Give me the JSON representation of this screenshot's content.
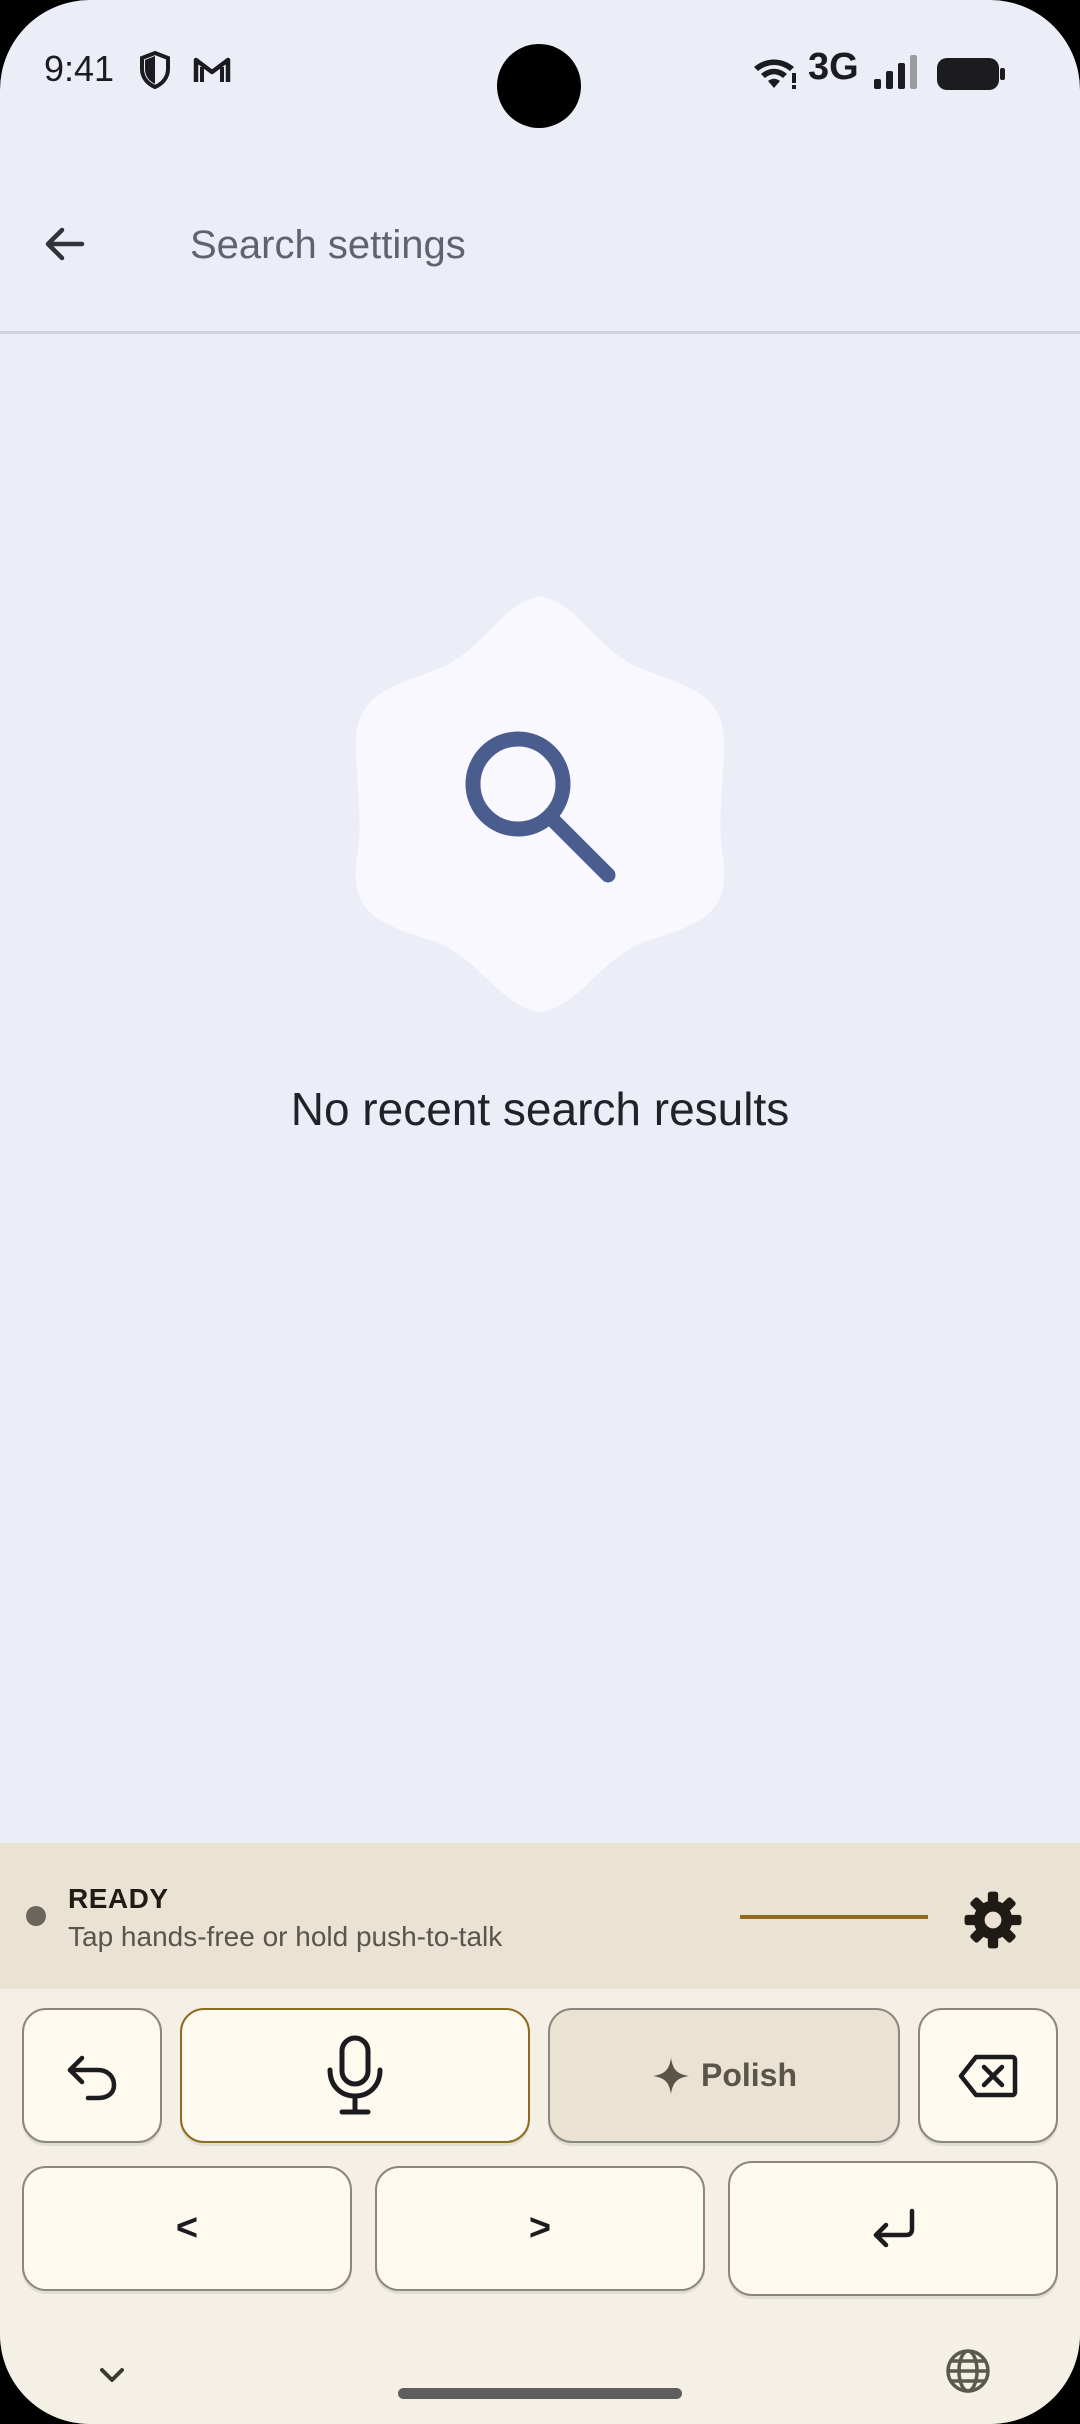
{
  "status_bar": {
    "time": "9:41",
    "network": "3G",
    "icons": [
      "shield-icon",
      "gmail-icon",
      "wifi-icon",
      "signal-icon",
      "battery-icon"
    ]
  },
  "search": {
    "placeholder": "Search settings",
    "back_icon": "arrow-back-icon"
  },
  "empty_state": {
    "icon": "search-icon",
    "message": "No recent search results"
  },
  "voice_keyboard": {
    "status_label": "READY",
    "hint": "Tap hands-free or hold push-to-talk",
    "settings_icon": "gear-icon",
    "keys": {
      "undo_icon": "undo-icon",
      "mic_icon": "microphone-icon",
      "polish_label": "Polish",
      "polish_icon": "sparkle-icon",
      "backspace_icon": "backspace-icon",
      "left_label": "<",
      "right_label": ">",
      "enter_icon": "enter-icon"
    },
    "bottom": {
      "collapse_icon": "chevron-down-icon",
      "language_icon": "globe-icon"
    }
  },
  "colors": {
    "background": "#eceef7",
    "accent": "#4b5d8f",
    "keyboard_bg": "#f4f0e6",
    "keyboard_status_bg": "#eae2d3",
    "mic_border": "#8d6b20"
  }
}
